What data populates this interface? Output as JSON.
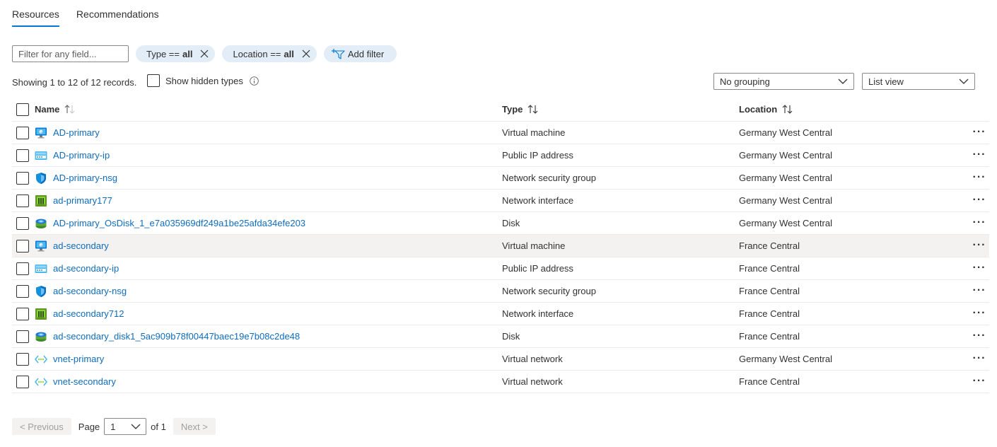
{
  "tabs": [
    {
      "label": "Resources",
      "active": true
    },
    {
      "label": "Recommendations",
      "active": false
    }
  ],
  "filter": {
    "placeholder": "Filter for any field...",
    "value": "",
    "pills": [
      {
        "key": "Type ==",
        "value": "all"
      },
      {
        "key": "Location ==",
        "value": "all"
      }
    ],
    "add_filter_label": "Add filter"
  },
  "records_text": "Showing 1 to 12 of 12 records.",
  "show_hidden_types_label": "Show hidden types",
  "grouping_select": "No grouping",
  "view_select": "List view",
  "columns": {
    "name": "Name",
    "type": "Type",
    "location": "Location"
  },
  "rows": [
    {
      "name": "AD-primary",
      "type": "Virtual machine",
      "location": "Germany West Central",
      "icon": "virtual-machine-icon"
    },
    {
      "name": "AD-primary-ip",
      "type": "Public IP address",
      "location": "Germany West Central",
      "icon": "public-ip-icon"
    },
    {
      "name": "AD-primary-nsg",
      "type": "Network security group",
      "location": "Germany West Central",
      "icon": "nsg-shield-icon"
    },
    {
      "name": "ad-primary177",
      "type": "Network interface",
      "location": "Germany West Central",
      "icon": "network-interface-icon"
    },
    {
      "name": "AD-primary_OsDisk_1_e7a035969df249a1be25afda34efe203",
      "type": "Disk",
      "location": "Germany West Central",
      "icon": "disk-icon"
    },
    {
      "name": "ad-secondary",
      "type": "Virtual machine",
      "location": "France Central",
      "icon": "virtual-machine-icon"
    },
    {
      "name": "ad-secondary-ip",
      "type": "Public IP address",
      "location": "France Central",
      "icon": "public-ip-icon"
    },
    {
      "name": "ad-secondary-nsg",
      "type": "Network security group",
      "location": "France Central",
      "icon": "nsg-shield-icon"
    },
    {
      "name": "ad-secondary712",
      "type": "Network interface",
      "location": "France Central",
      "icon": "network-interface-icon"
    },
    {
      "name": "ad-secondary_disk1_5ac909b78f00447baec19e7b08c2de48",
      "type": "Disk",
      "location": "France Central",
      "icon": "disk-icon"
    },
    {
      "name": "vnet-primary",
      "type": "Virtual network",
      "location": "Germany West Central",
      "icon": "virtual-network-icon"
    },
    {
      "name": "vnet-secondary",
      "type": "Virtual network",
      "location": "France Central",
      "icon": "virtual-network-icon"
    }
  ],
  "pagination": {
    "previous_label": "< Previous",
    "page_label": "Page",
    "current_page": "1",
    "of_label": "of 1",
    "next_label": "Next >"
  },
  "colors": {
    "accent": "#0078d4",
    "link": "#0f6cbd",
    "pill_bg": "#e2edf8",
    "hover_row": "#f3f2f1"
  }
}
